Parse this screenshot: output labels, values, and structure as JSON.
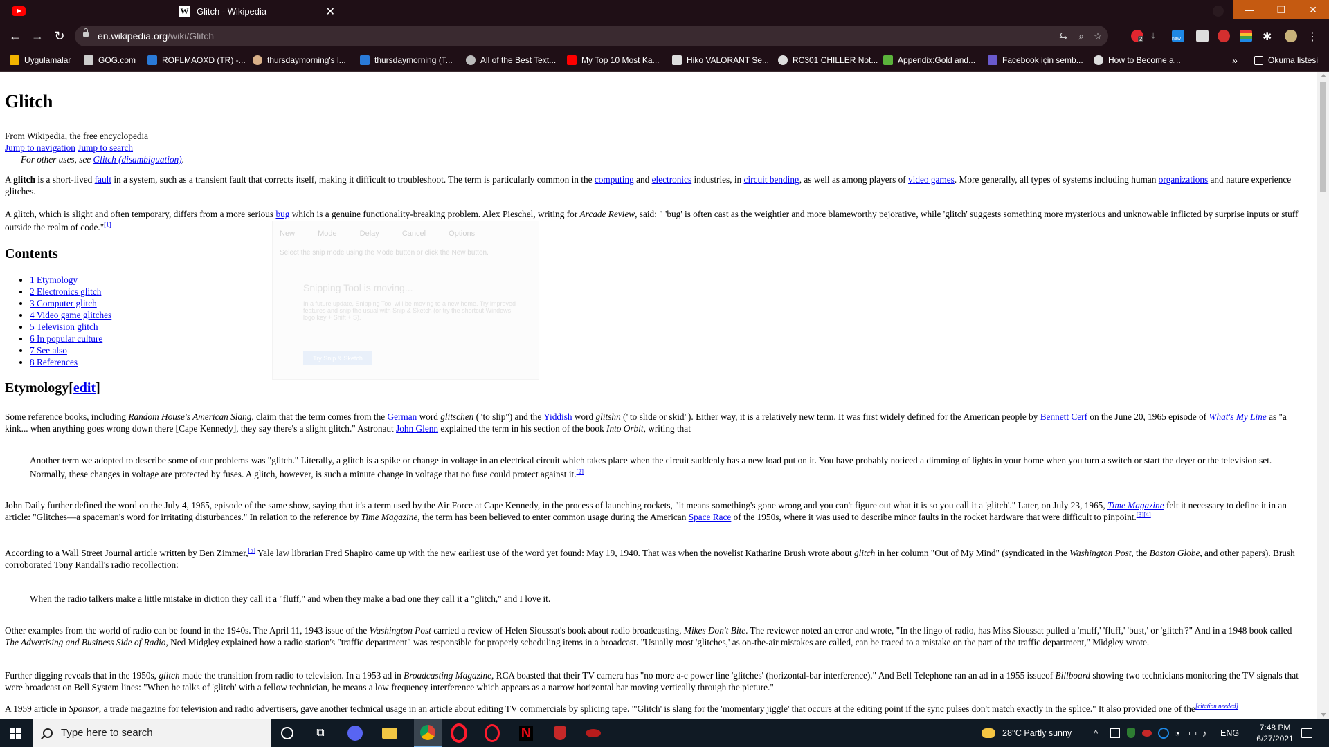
{
  "browser": {
    "tab_title": "Glitch - Wikipedia",
    "tab_favicon": "W",
    "url_host": "en.wikipedia.org",
    "url_path": "/wiki/Glitch",
    "window_minimize": "—",
    "window_restore": "❐",
    "window_close": "✕",
    "ext_abp_badge": "2",
    "ext_new_badge": "new"
  },
  "bookmarks": [
    {
      "label": "Uygulamalar",
      "icon": "apps-grid-icon",
      "color": "#f2b400"
    },
    {
      "label": "GOG.com",
      "icon": "gog-icon",
      "color": "#cccccc"
    },
    {
      "label": "ROFLMAOXD (TR) -...",
      "icon": "letter-l-icon",
      "color": "#2a7ad8"
    },
    {
      "label": "thursdaymorning's l...",
      "icon": "person-icon",
      "color": "#d9b089"
    },
    {
      "label": "thursdaymorning (T...",
      "icon": "letter-l-icon",
      "color": "#2a7ad8"
    },
    {
      "label": "All of the Best Text...",
      "icon": "swirl-icon",
      "color": "#bbbbbb"
    },
    {
      "label": "My Top 10 Most Ka...",
      "icon": "youtube-icon",
      "color": "#ff0000"
    },
    {
      "label": "Hiko VALORANT Se...",
      "icon": "wrench-icon",
      "color": "#dddddd"
    },
    {
      "label": "RC301 CHILLER Not...",
      "icon": "compass-icon",
      "color": "#dddddd"
    },
    {
      "label": "Appendix:Gold and...",
      "icon": "leaf-icon",
      "color": "#5bb33b"
    },
    {
      "label": "Facebook için semb...",
      "icon": "text-logo-icon",
      "color": "#6a5acd"
    },
    {
      "label": "How to Become a...",
      "icon": "info-circle-icon",
      "color": "#dddddd"
    }
  ],
  "bookmarks_more": "»",
  "reading_list": "Okuma listesi",
  "article": {
    "title": "Glitch",
    "from": "From Wikipedia, the free encyclopedia",
    "jump_nav": "Jump to navigation",
    "jump_search": "Jump to search",
    "hatnote_prefix": "For other uses, see ",
    "hatnote_link": "Glitch (disambiguation)",
    "hatnote_suffix": ".",
    "p1": {
      "a": "A ",
      "b": "glitch",
      "c": " is a short-lived ",
      "fault": "fault",
      "d": " in a system, such as a transient fault that corrects itself, making it difficult to troubleshoot. The term is particularly common in the ",
      "computing": "computing",
      "e": " and ",
      "electronics": "electronics",
      "f": " industries, in ",
      "circuit": "circuit bending",
      "g": ", as well as among players of ",
      "video": "video games",
      "h": ". More generally, all types of systems including human ",
      "org": "organizations",
      "i": " and nature experience glitches."
    },
    "p2": {
      "a": "A glitch, which is slight and often temporary, differs from a more serious ",
      "bug": "bug",
      "b": " which is a genuine functionality-breaking problem. Alex Pieschel, writing for ",
      "arcade": "Arcade Review",
      "c": ", said: \" 'bug' is often cast as the weightier and more blameworthy pejorative, while 'glitch' suggests something more mysterious and unknowable inflicted by surprise inputs or stuff outside the realm of code.\"",
      "ref": "[1]"
    },
    "contents_heading": "Contents",
    "toc": [
      "1 Etymology",
      "2 Electronics glitch",
      "3 Computer glitch",
      "4 Video game glitches",
      "5 Television glitch",
      "6 In popular culture",
      "7 See also",
      "8 References"
    ],
    "etym_heading": "Etymology",
    "edit_link": "edit",
    "p3": {
      "a": "Some reference books, including ",
      "rh": "Random House's American Slang",
      "b": ", claim that the term comes from the ",
      "german": "German",
      "c": " word ",
      "glitschen": "glitschen",
      "d": " (\"to slip\") and the ",
      "yiddish": "Yiddish",
      "e": " word ",
      "glitshn": "glitshn",
      "f": " (\"to slide or skid\"). Either way, it is a relatively new term. It was first widely defined for the American people by ",
      "cerf": "Bennett Cerf",
      "g": " on the June 20, 1965 episode of ",
      "wml": "What's My Line",
      "h": " as \"a kink... when anything goes wrong down there [Cape Kennedy], they say there's a slight glitch.\" Astronaut ",
      "glenn": "John Glenn",
      "i": " explained the term in his section of the book ",
      "orbit": "Into Orbit",
      "j": ", writing that"
    },
    "quote1": "Another term we adopted to describe some of our problems was \"glitch.\" Literally, a glitch is a spike or change in voltage in an electrical circuit which takes place when the circuit suddenly has a new load put on it. You have probably noticed a dimming of lights in your home when you turn a switch or start the dryer or the television set. Normally, these changes in voltage are protected by fuses. A glitch, however, is such a minute change in voltage that no fuse could protect against it.",
    "quote1_ref": "[2]",
    "p4": {
      "a": "John Daily further defined the word on the July 4, 1965, episode of the same show, saying that it's a term used by the Air Force at Cape Kennedy, in the process of launching rockets, \"it means something's gone wrong and you can't figure out what it is so you call it a 'glitch'.\" Later, on July 23, 1965, ",
      "time": "Time Magazine",
      "b": " felt it necessary to define it in an article: \"Glitches—a spaceman's word for irritating disturbances.\" In relation to the reference by ",
      "time2": "Time Magazine",
      "c": ", the term has been believed to enter common usage during the American ",
      "space": "Space Race",
      "d": " of the 1950s, where it was used to describe minor faults in the rocket hardware that were difficult to pinpoint.",
      "ref": "[3][4]"
    },
    "p5": {
      "a": "According to a Wall Street Journal article written by Ben Zimmer,",
      "ref": "[5]",
      "b": " Yale law librarian Fred Shapiro came up with the new earliest use of the word yet found: May 19, 1940. That was when the novelist Katharine Brush wrote about ",
      "glitch": "glitch",
      "c": " in her column \"Out of My Mind\" (syndicated in the ",
      "wp": "Washington Post",
      "d": ", the ",
      "bg": "Boston Globe",
      "e": ", and other papers). Brush corroborated Tony Randall's radio recollection:"
    },
    "quote2": "When the radio talkers make a little mistake in diction they call it a \"fluff,\" and when they make a bad one they call it a \"glitch,\" and I love it.",
    "p6": {
      "a": "Other examples from the world of radio can be found in the 1940s. The April 11, 1943 issue of the ",
      "wp": "Washington Post",
      "b": " carried a review of Helen Sioussat's book about radio broadcasting, ",
      "mdb": "Mikes Don't Bite",
      "c": ". The reviewer noted an error and wrote, \"In the lingo of radio, has Miss Sioussat pulled a 'muff,' 'fluff,' 'bust,' or 'glitch'?\" And in a 1948 book called ",
      "adv": "The Advertising and Business Side of Radio",
      "d": ", Ned Midgley explained how a radio station's \"traffic department\" was responsible for properly scheduling items in a broadcast. \"Usually most 'glitches,' as on-the-air mistakes are called, can be traced to a mistake on the part of the traffic department,\" Midgley wrote."
    },
    "p7": {
      "a": "Further digging reveals that in the 1950s, ",
      "glitch": "glitch",
      "b": " made the transition from radio to television. In a 1953 ad in ",
      "bm": "Broadcasting Magazine",
      "c": ", RCA boasted that their TV camera has \"no more a-c power line 'glitches' (horizontal-bar interference).\" And Bell Telephone ran an ad in a 1955 issueof ",
      "bb": "Billboard",
      "d": " showing two technicians monitoring the TV signals that were broadcast on Bell System lines: \"When he talks of 'glitch' with a fellow technician, he means a low frequency interference which appears as a narrow horizontal bar moving vertically through the picture.\""
    },
    "p8": {
      "a": "A 1959 article in ",
      "sponsor": "Sponsor",
      "b": ", a trade magazine for television and radio advertisers, gave another technical usage in an article about editing TV commercials by splicing tape. \"'Glitch' is slang for the 'momentary jiggle' that occurs at the editing point if the sync pulses don't match exactly in the splice.\" It also provided one of the",
      "ref": "[citation needed]"
    }
  },
  "ghost_overlay": {
    "new": "New",
    "mode": "Mode",
    "delay": "Delay",
    "cancel": "Cancel",
    "options": "Options",
    "hint": "Select the snip mode using the Mode button or click the New button.",
    "moving": "Snipping Tool is moving...",
    "body": "In a future update, Snipping Tool will be moving to a new home. Try improved features and snip the usual with Snip & Sketch (or try the shortcut Windows logo key + Shift + S).",
    "button": "Try Snip & Sketch"
  },
  "taskbar": {
    "search_placeholder": "Type here to search",
    "weather": "28°C  Partly sunny",
    "language": "ENG",
    "time": "7:48 PM",
    "date": "6/27/2021"
  }
}
